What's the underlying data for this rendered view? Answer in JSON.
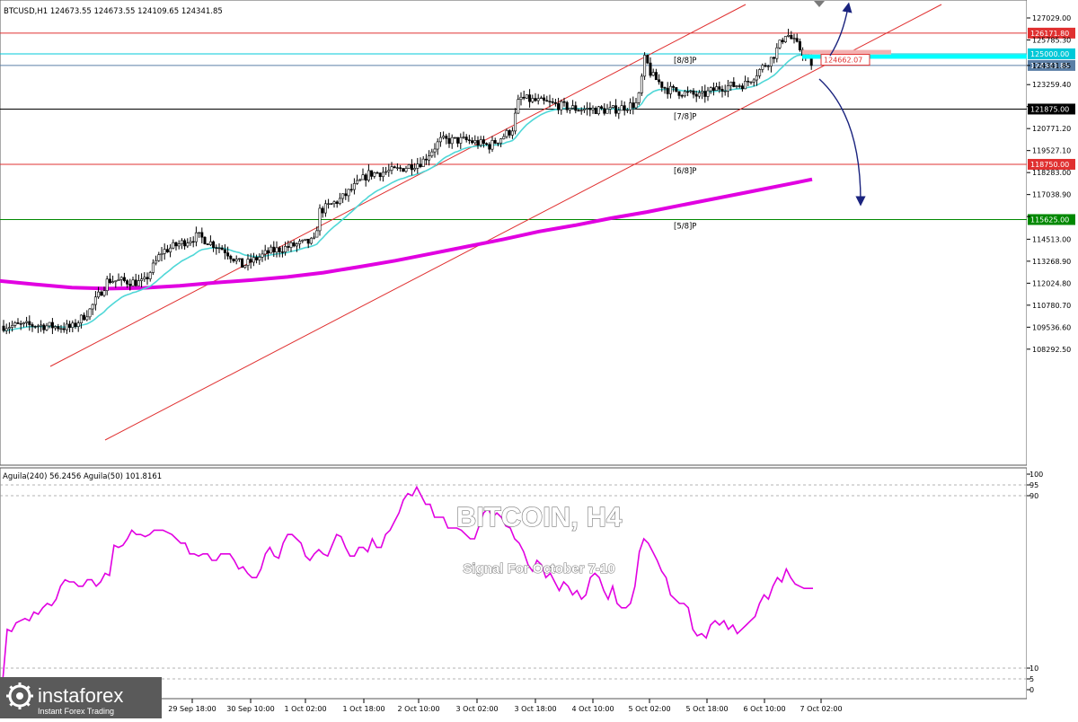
{
  "header": {
    "symbol_line": "BTCUSD,H1  124673.55  124673.55  124109.65  124341.85"
  },
  "watermark": {
    "title": "BITCOIN, H4",
    "subtitle": "Signal For October 7-10"
  },
  "logo": {
    "brand": "instaforex",
    "tagline": "Instant Forex Trading"
  },
  "colors": {
    "candle_up": "#ffffff",
    "candle_down": "#000000",
    "ema_fast": "#4fd7d7",
    "ma_slow": "#e100e1",
    "channel": "#e03030",
    "oscillator": "#e100e1",
    "arrow": "#1a237e",
    "highlight_cyan": "#00ffff",
    "highlight_rose": "#f3b0b0"
  },
  "chart_data": [
    {
      "type": "candlestick",
      "symbol": "BTCUSD",
      "timeframe": "H1",
      "ohlc_header": {
        "open": 124673.55,
        "high": 124673.55,
        "low": 124109.65,
        "close": 124341.85
      },
      "y_ticks": [
        127029.0,
        125785.3,
        124341.85,
        123259.4,
        122015.7,
        120771.2,
        119527.1,
        118283.0,
        117038.9,
        115794.8,
        114513.0,
        113268.9,
        112024.8,
        110780.7,
        109536.6,
        108292.5
      ],
      "y_tick_labels": [
        "127029.00",
        "125785.30",
        "124341.85",
        "123259.40",
        "",
        "120771.20",
        "119527.10",
        "118283.00",
        "117038.90",
        "",
        "114513.00",
        "113268.90",
        "112024.80",
        "110780.70",
        "109536.60",
        "108292.50"
      ],
      "ylim": [
        108292.5,
        127500.0
      ],
      "x_tick_labels": [
        "29 Sep 18:00",
        "30 Sep 10:00",
        "1 Oct 02:00",
        "1 Oct 18:00",
        "2 Oct 10:00",
        "3 Oct 02:00",
        "3 Oct 18:00",
        "4 Oct 10:00",
        "5 Oct 02:00",
        "5 Oct 18:00",
        "6 Oct 10:00",
        "7 Oct 02:00"
      ],
      "price_lines": [
        {
          "value": 126171.8,
          "label": "126171.80",
          "color": "#e03030",
          "tag": ""
        },
        {
          "value": 125000.0,
          "label": "125000.00",
          "color": "#00c8d8",
          "tag": "[8/8]P"
        },
        {
          "value": 124341.85,
          "label": "124341.85",
          "color": "#5b7fa6",
          "tag": ""
        },
        {
          "value": 121875.0,
          "label": "121875.00",
          "color": "#000000",
          "tag": "[7/8]P"
        },
        {
          "value": 118750.0,
          "label": "118750.00",
          "color": "#e03030",
          "tag": "[6/8]P"
        },
        {
          "value": 115625.0,
          "label": "115625.00",
          "color": "#008800",
          "tag": "[5/8]P"
        }
      ],
      "annotation_price": "124662.07",
      "ma200_points": [
        [
          0,
          112150
        ],
        [
          40,
          111950
        ],
        [
          80,
          111780
        ],
        [
          120,
          111720
        ],
        [
          160,
          111760
        ],
        [
          200,
          111880
        ],
        [
          240,
          112060
        ],
        [
          280,
          112200
        ],
        [
          320,
          112380
        ],
        [
          360,
          112620
        ],
        [
          400,
          112950
        ],
        [
          440,
          113300
        ],
        [
          480,
          113700
        ],
        [
          520,
          114100
        ],
        [
          560,
          114500
        ],
        [
          600,
          114950
        ],
        [
          640,
          115300
        ],
        [
          680,
          115700
        ],
        [
          720,
          116050
        ],
        [
          760,
          116450
        ],
        [
          800,
          116850
        ],
        [
          840,
          117250
        ],
        [
          880,
          117650
        ],
        [
          904,
          117900
        ]
      ]
    },
    {
      "type": "line",
      "series": [
        {
          "name": "Aguila(240) 56.2456",
          "values": [
            4,
            28,
            27,
            31,
            32,
            33,
            32,
            36,
            35,
            38,
            40,
            39,
            42,
            48,
            51,
            50,
            50,
            48,
            48,
            51,
            51,
            48,
            50,
            54,
            53,
            67,
            66,
            67,
            70,
            74,
            72,
            72,
            71,
            72,
            74,
            74,
            74,
            73,
            72,
            70,
            68,
            68,
            63,
            63,
            62,
            63,
            63,
            60,
            60,
            63,
            63,
            63,
            60,
            56,
            57,
            54,
            52,
            52,
            56,
            63,
            66,
            62,
            61,
            68,
            72,
            72,
            70,
            68,
            62,
            60,
            63,
            65,
            63,
            62,
            67,
            72,
            71,
            66,
            62,
            62,
            66,
            66,
            64,
            70,
            66,
            66,
            72,
            74,
            78,
            82,
            88,
            91,
            90,
            94,
            90,
            86,
            86,
            80,
            80,
            80,
            75,
            75,
            75,
            74,
            72,
            70,
            70,
            76,
            82,
            84,
            80,
            82,
            80,
            76,
            75,
            70,
            68,
            64,
            58,
            55,
            60,
            58,
            52,
            54,
            50,
            46,
            50,
            48,
            44,
            46,
            42,
            44,
            52,
            54,
            52,
            46,
            42,
            48,
            40,
            38,
            38,
            40,
            48,
            64,
            70,
            68,
            64,
            60,
            55,
            52,
            44,
            42,
            40,
            40,
            38,
            28,
            25,
            26,
            24,
            30,
            32,
            30,
            32,
            28,
            30,
            26,
            28,
            30,
            32,
            34,
            40,
            44,
            42,
            48,
            52,
            50,
            56,
            52,
            49,
            48,
            47,
            47,
            47
          ]
        }
      ],
      "header": "Aguila(240) 56.2456   Aguila(50) 101.8161",
      "ylim": [
        0,
        100
      ],
      "y_ticks": [
        100,
        95,
        90,
        10,
        5,
        0
      ],
      "y_tick_labels": [
        "100",
        "95",
        "90",
        "10",
        "5",
        "0"
      ]
    }
  ]
}
